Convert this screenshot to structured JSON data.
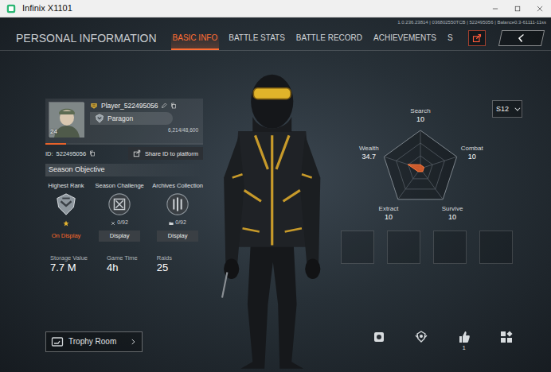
{
  "window": {
    "title": "Infinix X1101"
  },
  "build_info": "1.0.236.23814 | 036802550TCB | 522495056 | Balance0.3-61111-11ss",
  "header": {
    "title": "PERSONAL INFORMATION"
  },
  "tabs": [
    {
      "label": "BASIC INFO",
      "selected": true
    },
    {
      "label": "BATTLE STATS",
      "selected": false
    },
    {
      "label": "BATTLE RECORD",
      "selected": false
    },
    {
      "label": "ACHIEVEMENTS",
      "selected": false
    },
    {
      "label": "S",
      "selected": false
    }
  ],
  "profile": {
    "level": "24",
    "name": "Player_522495056",
    "rank": "Paragon",
    "exp": "6,214/48,600",
    "exp_level": 0.13,
    "id_label": "ID:",
    "id": "522495056",
    "share_button": "Share ID to platform"
  },
  "season_objective": {
    "title": "Season Objective",
    "items": [
      {
        "kind": "rank",
        "label": "Highest Rank",
        "stars": 1,
        "button": "On Display",
        "displayed": true
      },
      {
        "kind": "counter",
        "label": "Season Challenge",
        "count": "0/92",
        "button": "Display",
        "displayed": false
      },
      {
        "kind": "counter",
        "label": "Archives Collection",
        "count": "0/92",
        "button": "Display",
        "displayed": false
      }
    ]
  },
  "stats": [
    {
      "label": "Storage Value",
      "value": "7.7 M"
    },
    {
      "label": "Game Time",
      "value": "4h"
    },
    {
      "label": "Raids",
      "value": "25"
    }
  ],
  "trophy_room": {
    "label": "Trophy Room"
  },
  "radar": {
    "axes": [
      {
        "label": "Search",
        "value": "10"
      },
      {
        "label": "Combat",
        "value": "10"
      },
      {
        "label": "Survive",
        "value": "10"
      },
      {
        "label": "Extract",
        "value": "10"
      },
      {
        "label": "Wealth",
        "value": "34.7"
      }
    ],
    "values": [
      10,
      10,
      10,
      10,
      34.7
    ]
  },
  "season_select": {
    "value": "S12"
  },
  "likes": {
    "count": "1"
  }
}
